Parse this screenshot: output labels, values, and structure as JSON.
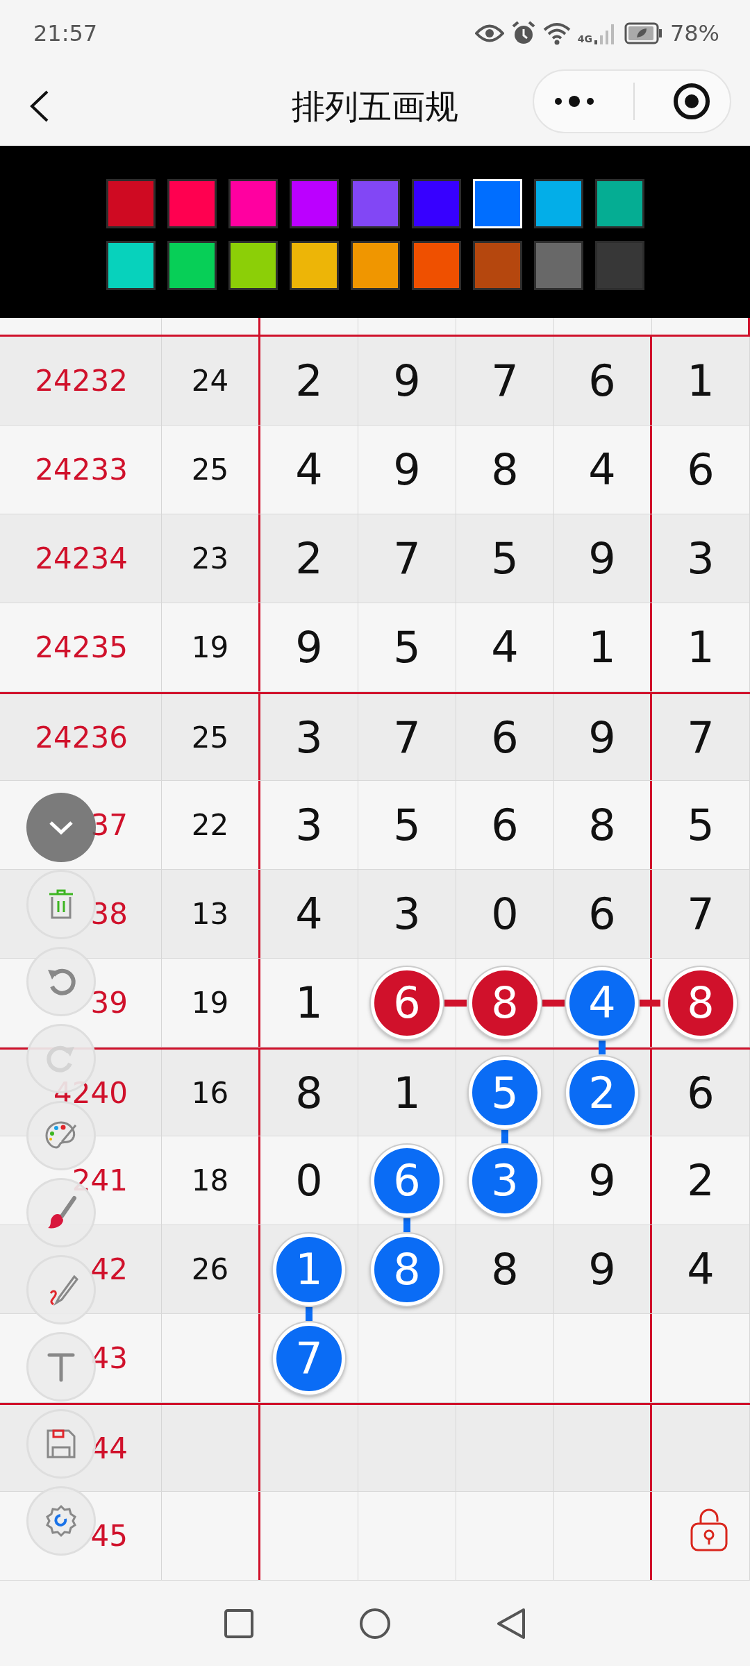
{
  "status_bar": {
    "time": "21:57",
    "network": "4G",
    "battery": "78%"
  },
  "header": {
    "title": "排列五画规"
  },
  "palette": [
    {
      "color": "#cf0a22",
      "selected": false
    },
    {
      "color": "#ff0050",
      "selected": false
    },
    {
      "color": "#ff00a0",
      "selected": false
    },
    {
      "color": "#bb00ff",
      "selected": false
    },
    {
      "color": "#8247f5",
      "selected": false
    },
    {
      "color": "#3700ff",
      "selected": false
    },
    {
      "color": "#006eff",
      "selected": true
    },
    {
      "color": "#03aee8",
      "selected": false
    },
    {
      "color": "#05ad93",
      "selected": false
    },
    {
      "color": "#07d2bc",
      "selected": false
    },
    {
      "color": "#07cf57",
      "selected": false
    },
    {
      "color": "#8ccf07",
      "selected": false
    },
    {
      "color": "#edb507",
      "selected": false
    },
    {
      "color": "#f09600",
      "selected": false
    },
    {
      "color": "#ef5000",
      "selected": false
    },
    {
      "color": "#b5470e",
      "selected": false
    },
    {
      "color": "#686868",
      "selected": false
    },
    {
      "color": "#373737",
      "selected": false
    }
  ],
  "rows": [
    {
      "label": "24232",
      "sum": "24",
      "digits": [
        {
          "text": "2"
        },
        {
          "text": "9"
        },
        {
          "text": "7"
        },
        {
          "text": "6"
        },
        {
          "text": "1"
        }
      ]
    },
    {
      "label": "24233",
      "sum": "25",
      "digits": [
        {
          "text": "4"
        },
        {
          "text": "9"
        },
        {
          "text": "8"
        },
        {
          "text": "4"
        },
        {
          "text": "6"
        }
      ]
    },
    {
      "label": "24234",
      "sum": "23",
      "digits": [
        {
          "text": "2"
        },
        {
          "text": "7"
        },
        {
          "text": "5"
        },
        {
          "text": "9"
        },
        {
          "text": "3"
        }
      ]
    },
    {
      "label": "24235",
      "sum": "19",
      "digits": [
        {
          "text": "9"
        },
        {
          "text": "5"
        },
        {
          "text": "4"
        },
        {
          "text": "1"
        },
        {
          "text": "1"
        }
      ]
    },
    {
      "label": "24236",
      "sum": "25",
      "digits": [
        {
          "text": "3"
        },
        {
          "text": "7"
        },
        {
          "text": "6"
        },
        {
          "text": "9"
        },
        {
          "text": "7"
        }
      ]
    },
    {
      "label": "37",
      "sum": "22",
      "digits": [
        {
          "text": "3"
        },
        {
          "text": "5"
        },
        {
          "text": "6"
        },
        {
          "text": "8"
        },
        {
          "text": "5"
        }
      ]
    },
    {
      "label": "38",
      "sum": "13",
      "digits": [
        {
          "text": "4"
        },
        {
          "text": "3"
        },
        {
          "text": "0"
        },
        {
          "text": "6"
        },
        {
          "text": "7"
        }
      ]
    },
    {
      "label": "39",
      "sum": "19",
      "digits": [
        {
          "text": "1"
        },
        {
          "text": "6",
          "circle": {
            "color": "#d0112b"
          },
          "line_right": {
            "color": "#d0112b"
          }
        },
        {
          "text": "8",
          "circle": {
            "color": "#d0112b"
          },
          "line_right": {
            "color": "#d0112b"
          }
        },
        {
          "text": "4",
          "circle": {
            "color": "#0a6cf5"
          },
          "line_right": {
            "color": "#d0112b"
          },
          "line_down": {
            "color": "#0a6cf5"
          }
        },
        {
          "text": "8",
          "circle": {
            "color": "#d0112b"
          }
        }
      ]
    },
    {
      "label": "4240",
      "sum": "16",
      "digits": [
        {
          "text": "8"
        },
        {
          "text": "1"
        },
        {
          "text": "5",
          "circle": {
            "color": "#0a6cf5"
          },
          "line_down": {
            "color": "#0a6cf5"
          }
        },
        {
          "text": "2",
          "circle": {
            "color": "#0a6cf5"
          }
        },
        {
          "text": "6"
        }
      ]
    },
    {
      "label": "241",
      "sum": "18",
      "digits": [
        {
          "text": "0"
        },
        {
          "text": "6",
          "circle": {
            "color": "#0a6cf5"
          },
          "line_down": {
            "color": "#0a6cf5"
          }
        },
        {
          "text": "3",
          "circle": {
            "color": "#0a6cf5"
          }
        },
        {
          "text": "9"
        },
        {
          "text": "2"
        }
      ]
    },
    {
      "label": "42",
      "sum": "26",
      "digits": [
        {
          "text": "1",
          "circle": {
            "color": "#0a6cf5"
          },
          "line_down": {
            "color": "#0a6cf5"
          }
        },
        {
          "text": "8",
          "circle": {
            "color": "#0a6cf5"
          }
        },
        {
          "text": "8"
        },
        {
          "text": "9"
        },
        {
          "text": "4"
        }
      ]
    },
    {
      "label": "43",
      "digits": [
        {
          "text": "7",
          "circle": {
            "color": "#0a6cf5"
          }
        }
      ]
    },
    {
      "label": "44",
      "digits": []
    },
    {
      "label": "45",
      "digits": []
    }
  ],
  "tools": [
    {
      "kind": "collapse",
      "disabled": false
    },
    {
      "kind": "trash",
      "disabled": false
    },
    {
      "kind": "undo",
      "disabled": false
    },
    {
      "kind": "redo",
      "disabled": true
    },
    {
      "kind": "palette",
      "disabled": false
    },
    {
      "kind": "brush",
      "disabled": false
    },
    {
      "kind": "pen",
      "disabled": false
    },
    {
      "kind": "text",
      "disabled": false
    },
    {
      "kind": "save",
      "disabled": false
    },
    {
      "kind": "settings",
      "disabled": false
    }
  ]
}
